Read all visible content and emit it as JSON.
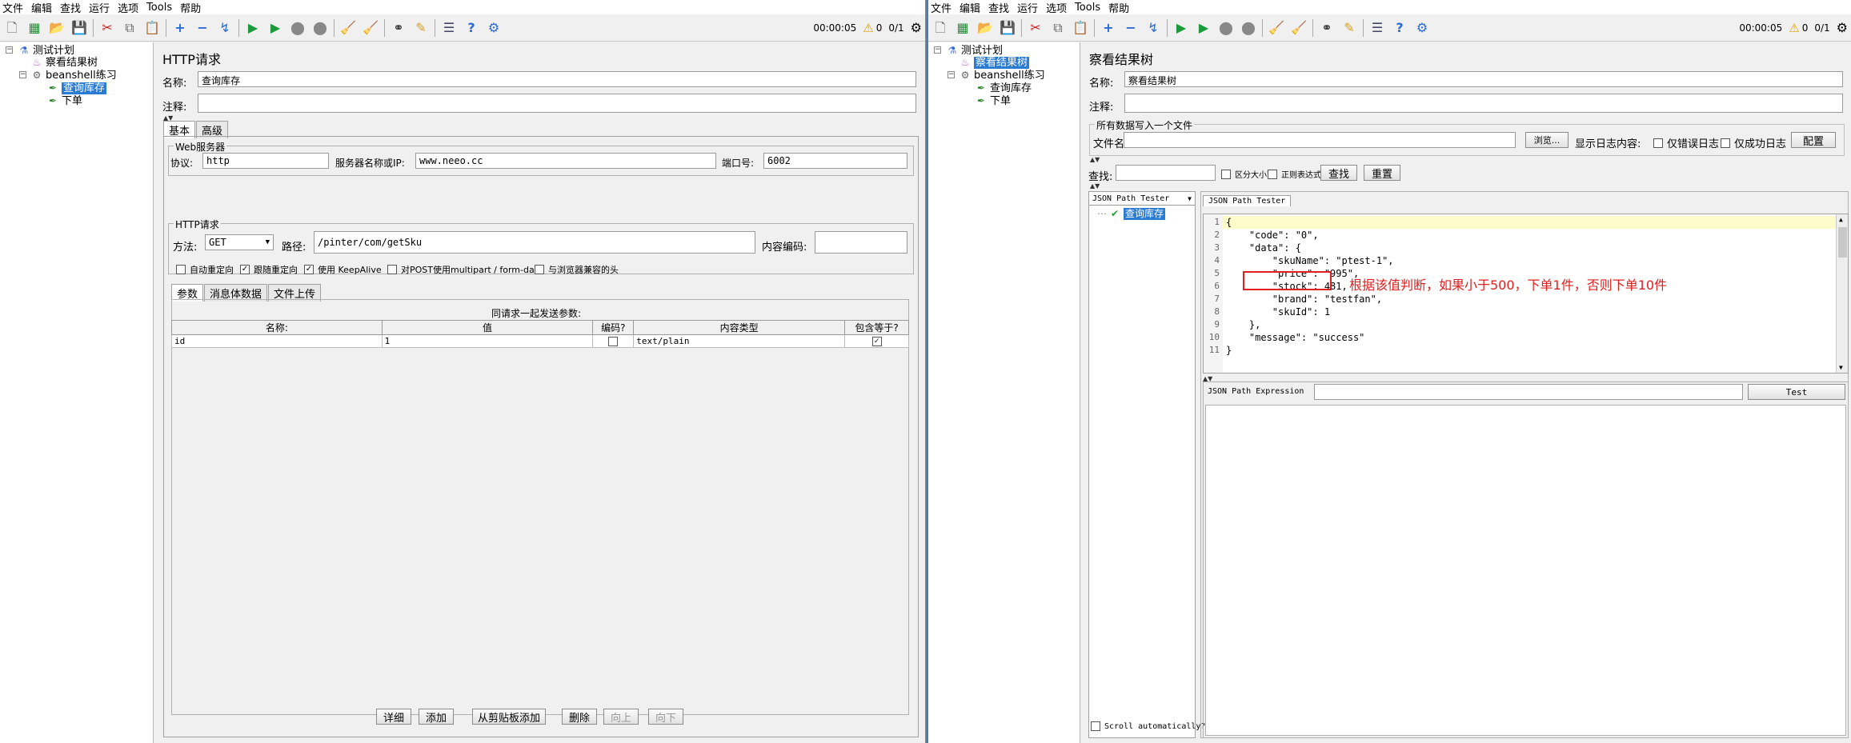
{
  "menu": [
    "文件",
    "编辑",
    "查找",
    "运行",
    "选项",
    "Tools",
    "帮助"
  ],
  "status": {
    "timer": "00:00:05",
    "warn": "0",
    "threads": "0/1"
  },
  "icons": {
    "new": "new-file-icon",
    "templates": "templates-icon",
    "open": "open-icon",
    "save": "save-icon",
    "cut": "cut-icon",
    "copy": "copy-icon",
    "paste": "paste-icon",
    "expand": "plus-icon",
    "collapse": "minus-icon",
    "toggle": "toggle-icon",
    "start": "play-icon",
    "start_nopause": "play-no-timer-icon",
    "stop": "stop-icon",
    "shutdown": "shutdown-icon",
    "clear": "broom-icon",
    "clear_all": "broom-all-icon",
    "search": "binoculars-icon",
    "reset_search": "reset-search-icon",
    "function": "function-helper-icon",
    "help": "help-icon",
    "remote": "remote-icon",
    "warning": "warning-icon",
    "threads": "threads-icon"
  },
  "left": {
    "tree": {
      "plan": "测试计划",
      "result_tree": "察看结果树",
      "thread_group": "beanshell练习",
      "sampler": "查询库存",
      "order": "下单"
    },
    "panel": {
      "title": "HTTP请求",
      "name_label": "名称:",
      "name_value": "查询库存",
      "comment_label": "注释:",
      "comment_value": "",
      "tabs": [
        "基本",
        "高级"
      ],
      "web_group": "Web服务器",
      "protocol_label": "协议:",
      "protocol_value": "http",
      "server_label": "服务器名称或IP:",
      "server_value": "www.neeo.cc",
      "port_label": "端口号:",
      "port_value": "6002",
      "http_group": "HTTP请求",
      "method_label": "方法:",
      "method_value": "GET",
      "path_label": "路径:",
      "path_value": "/pinter/com/getSku",
      "encoding_label": "内容编码:",
      "encoding_value": "",
      "checkboxes": [
        {
          "label": "自动重定向",
          "checked": false
        },
        {
          "label": "跟随重定向",
          "checked": true
        },
        {
          "label": "使用 KeepAlive",
          "checked": true
        },
        {
          "label": "对POST使用multipart / form-data",
          "checked": false
        },
        {
          "label": "与浏览器兼容的头",
          "checked": false
        }
      ],
      "subtabs": [
        "参数",
        "消息体数据",
        "文件上传"
      ],
      "params_title": "同请求一起发送参数:",
      "params_headers": [
        "名称:",
        "值",
        "编码?",
        "内容类型",
        "包含等于?"
      ],
      "params_rows": [
        {
          "name": "id",
          "value": "1",
          "encode": false,
          "type": "text/plain",
          "include_eq": true
        }
      ],
      "buttons": [
        {
          "label": "详细",
          "enabled": true
        },
        {
          "label": "添加",
          "enabled": true
        },
        {
          "label": "从剪贴板添加",
          "enabled": true
        },
        {
          "label": "删除",
          "enabled": true
        },
        {
          "label": "向上",
          "enabled": false
        },
        {
          "label": "向下",
          "enabled": false
        }
      ]
    }
  },
  "right": {
    "tree": {
      "plan": "测试计划",
      "result_tree": "察看结果树",
      "thread_group": "beanshell练习",
      "sampler": "查询库存",
      "order": "下单"
    },
    "panel": {
      "title": "察看结果树",
      "name_label": "名称:",
      "name_value": "察看结果树",
      "comment_label": "注释:",
      "comment_value": "",
      "file_group": "所有数据写入一个文件",
      "file_label": "文件名",
      "file_value": "",
      "browse": "浏览...",
      "log_label": "显示日志内容:",
      "errors_only": "仅错误日志",
      "success_only": "仅成功日志",
      "configure": "配置",
      "search_label": "查找:",
      "search_value": "",
      "case_sensitive": "区分大小写",
      "regex": "正则表达式",
      "find": "查找",
      "reset": "重置",
      "renderer": "JSON Path Tester",
      "result_item": "查询库存",
      "result_tab": "JSON Path Tester",
      "code_lines": [
        "{",
        "    \"code\": \"0\",",
        "    \"data\": {",
        "        \"skuName\": \"ptest-1\",",
        "        \"price\": \"995\",",
        "        \"stock\": 481,",
        "        \"brand\": \"testfan\",",
        "        \"skuId\": 1",
        "    },",
        "    \"message\": \"success\"",
        "}"
      ],
      "line_numbers": [
        "1",
        "2",
        "3",
        "4",
        "5",
        "6",
        "7",
        "8",
        "9",
        "10",
        "11"
      ],
      "annotation": "根据该值判断，如果小于500，下单1件，否则下单10件",
      "jsonpath_label": "JSON Path Expression",
      "jsonpath_value": "",
      "test": "Test",
      "scroll_auto": "Scroll automatically?"
    }
  }
}
